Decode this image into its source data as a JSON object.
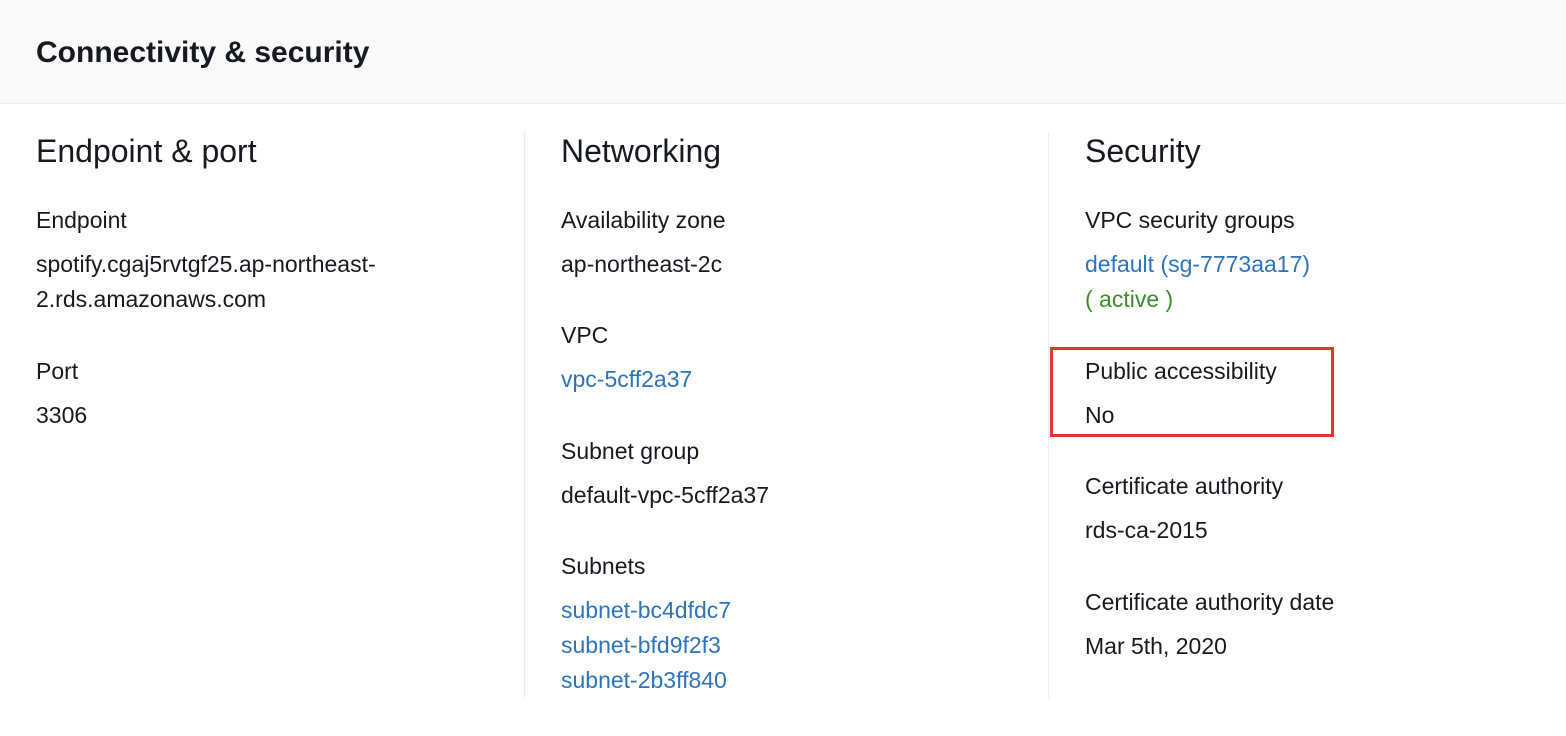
{
  "panel": {
    "title": "Connectivity & security"
  },
  "endpoint_port": {
    "heading": "Endpoint & port",
    "endpoint_label": "Endpoint",
    "endpoint_value_line1": "spotify.cgaj5rvtgf25.ap-northeast-",
    "endpoint_value_line2": "2.rds.amazonaws.com",
    "port_label": "Port",
    "port_value": "3306"
  },
  "networking": {
    "heading": "Networking",
    "az_label": "Availability zone",
    "az_value": "ap-northeast-2c",
    "vpc_label": "VPC",
    "vpc_value": "vpc-5cff2a37",
    "subnet_group_label": "Subnet group",
    "subnet_group_value": "default-vpc-5cff2a37",
    "subnets_label": "Subnets",
    "subnets": [
      "subnet-bc4dfdc7",
      "subnet-bfd9f2f3",
      "subnet-2b3ff840"
    ]
  },
  "security": {
    "heading": "Security",
    "sg_label": "VPC security groups",
    "sg_value": "default (sg-7773aa17)",
    "sg_status": "( active )",
    "public_access_label": "Public accessibility",
    "public_access_value": "No",
    "ca_label": "Certificate authority",
    "ca_value": "rds-ca-2015",
    "ca_date_label": "Certificate authority date",
    "ca_date_value": "Mar 5th, 2020"
  },
  "colors": {
    "link": "#2e73b8",
    "active_status": "#3d8b2f",
    "highlight_border": "#e0362c",
    "header_bg": "#fafafa"
  }
}
